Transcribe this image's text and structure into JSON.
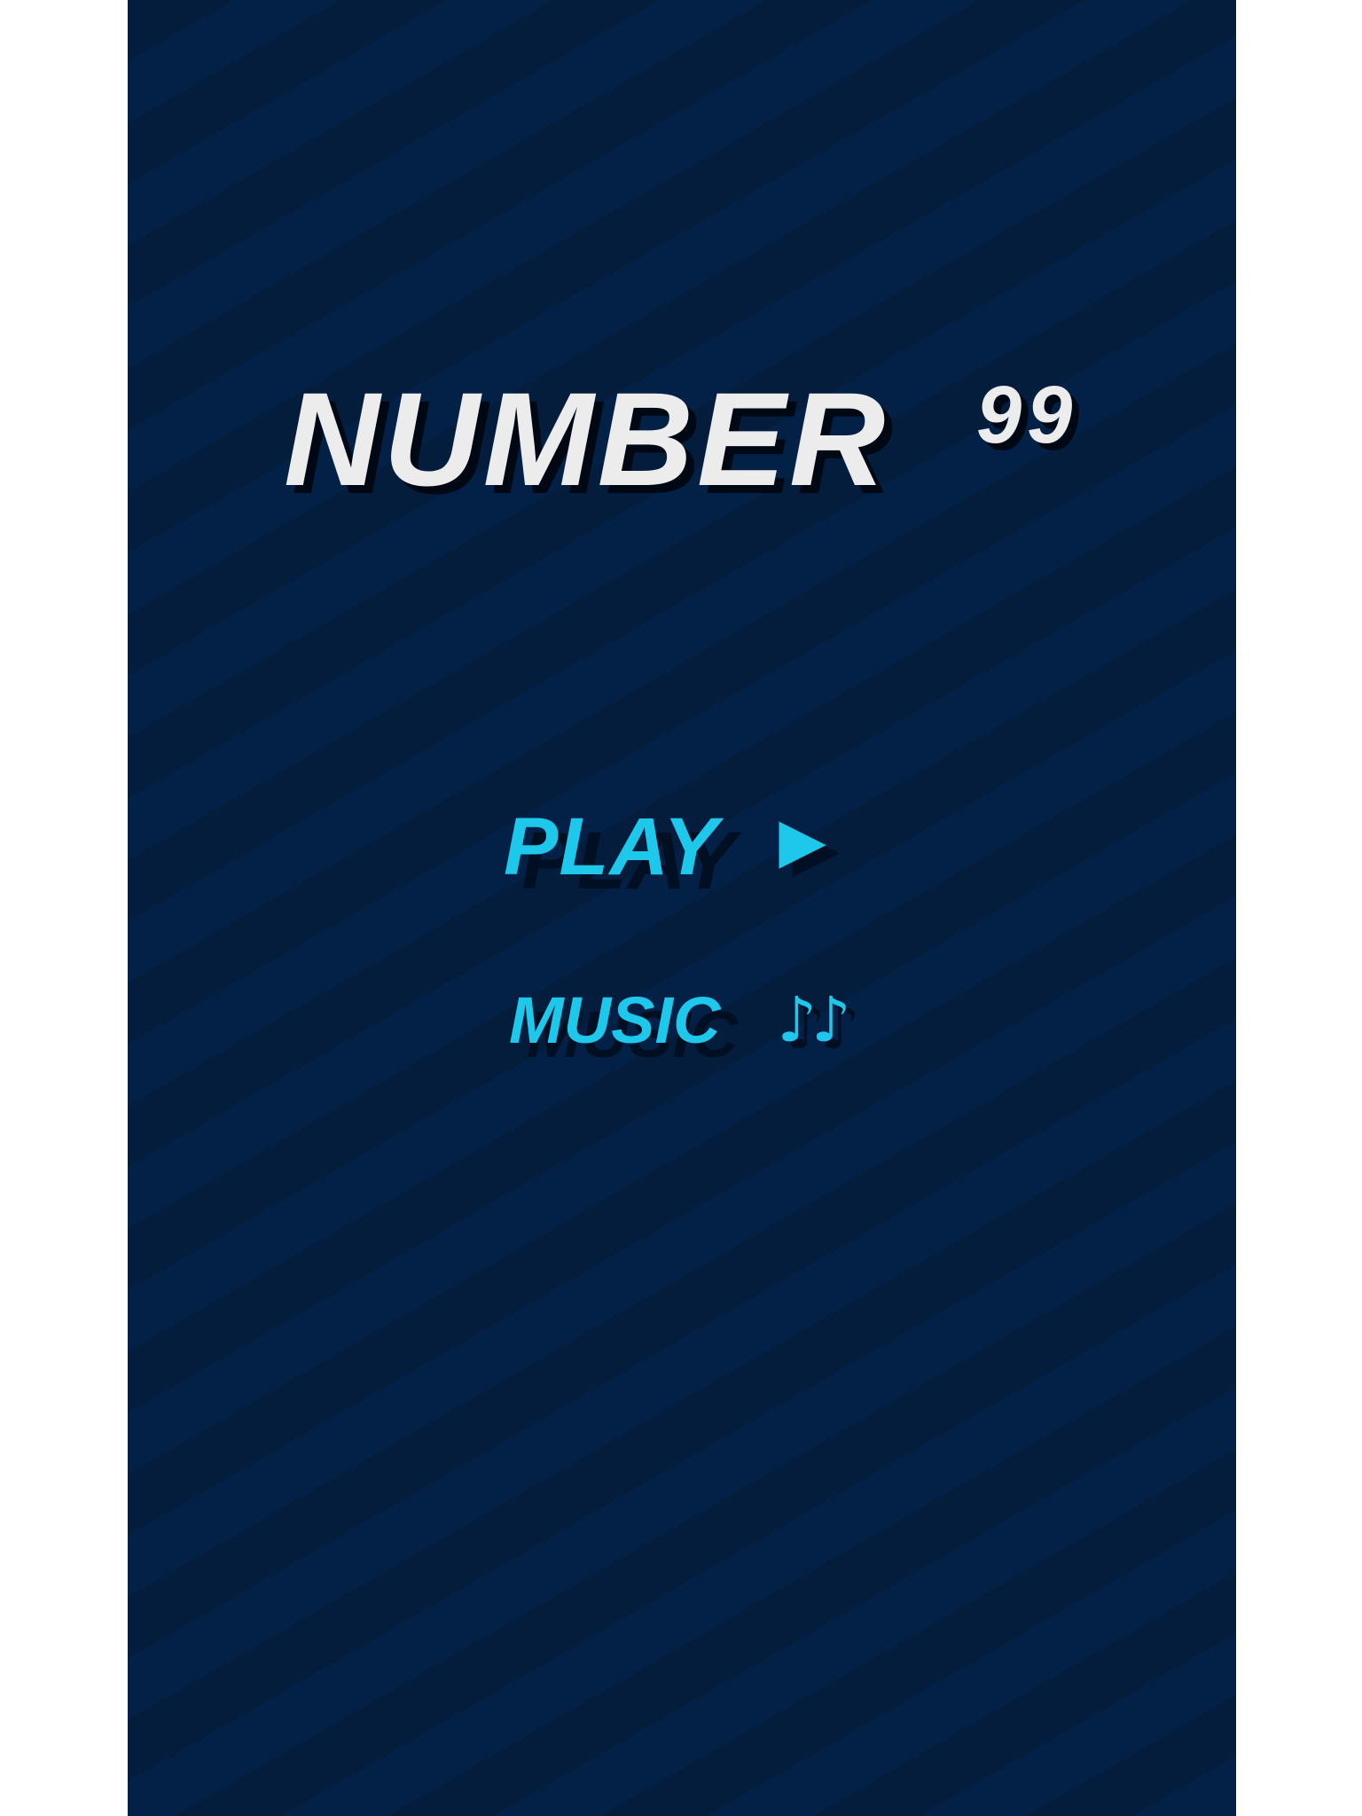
{
  "game": {
    "title": "NUMBER",
    "title_superscript": "99"
  },
  "menu": {
    "play_label": "PLAY",
    "play_icon": "play-triangle-icon",
    "music_label": "MUSIC",
    "music_icon_glyph": "♪♪",
    "music_icon": "music-notes-icon"
  },
  "colors": {
    "background": "#031d3d",
    "title_text": "#ececec",
    "accent": "#1ec8ea",
    "side_margin": "#ffffff"
  }
}
